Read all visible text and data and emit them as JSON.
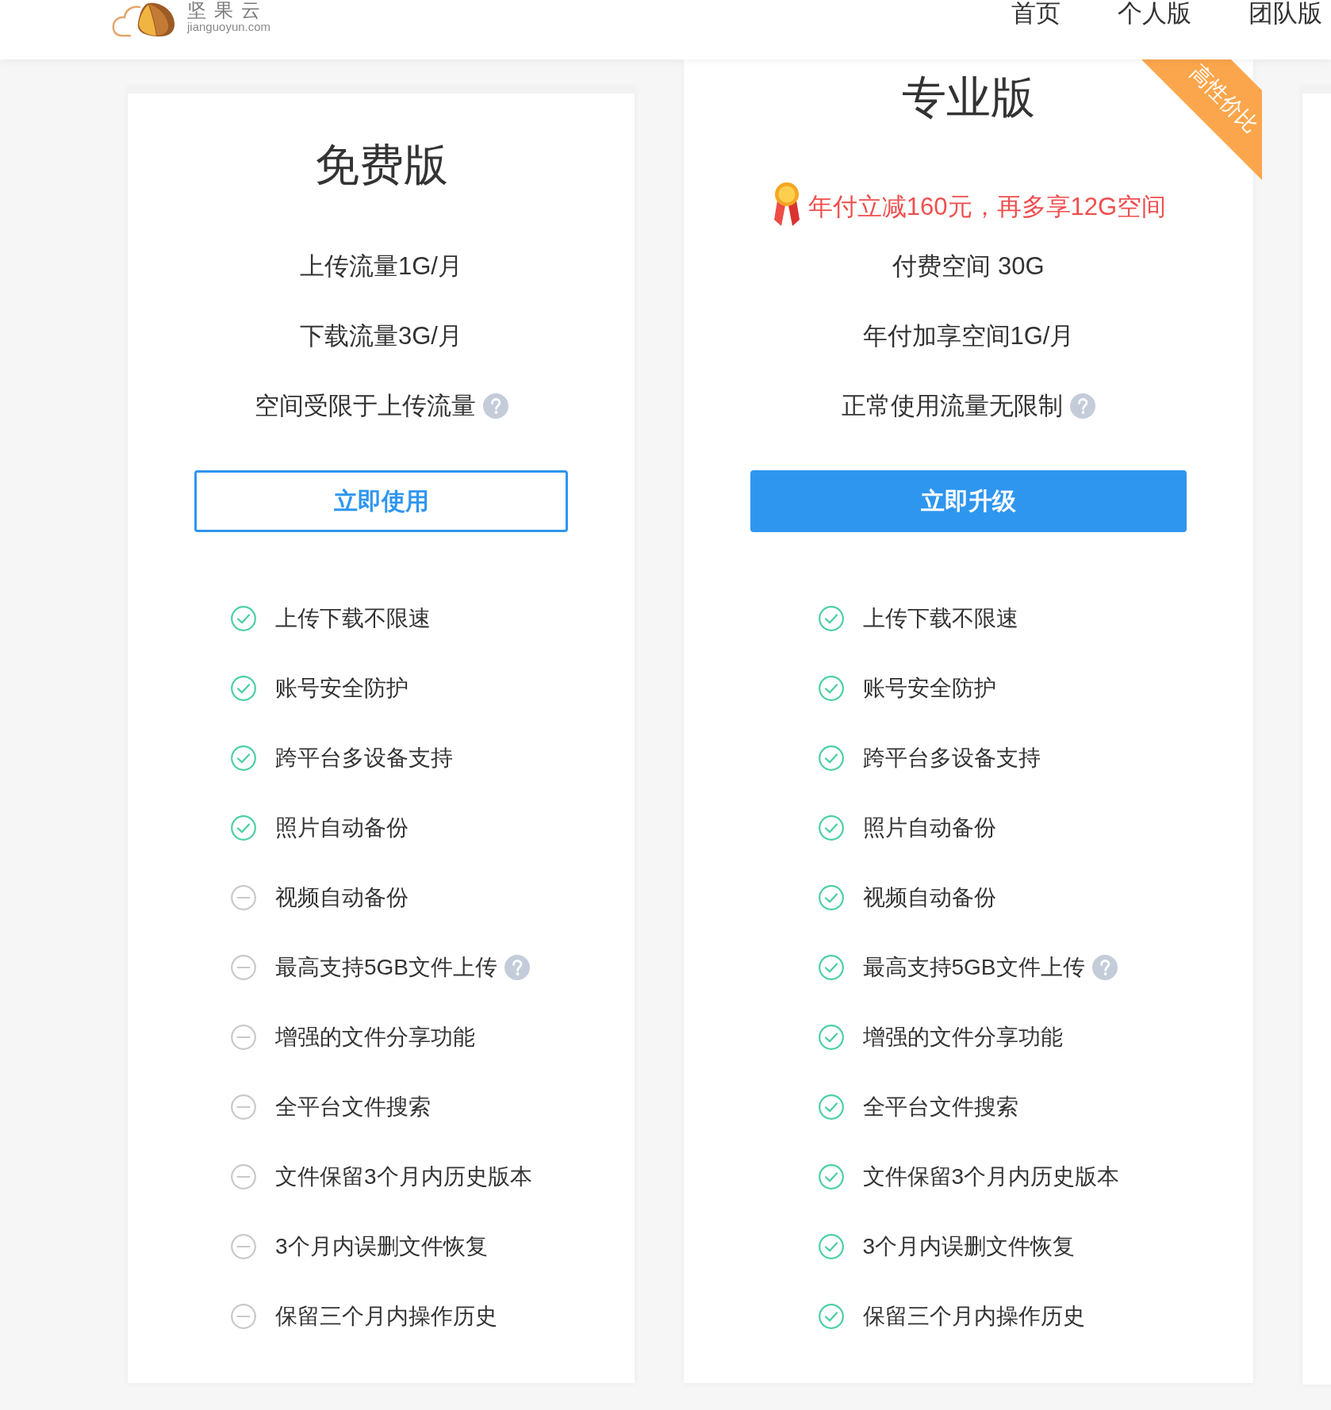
{
  "header": {
    "logo": {
      "name": "坚果云",
      "domain": "jianguoyun.com"
    },
    "nav": [
      {
        "label": "首页",
        "selected": false
      },
      {
        "label": "个人版",
        "selected": false
      },
      {
        "label": "团队版",
        "selected": false
      }
    ]
  },
  "plans": [
    {
      "title": "免费版",
      "featured": false,
      "specs": [
        {
          "text": "上传流量1G/月"
        },
        {
          "text": "下载流量3G/月"
        },
        {
          "text": "空间受限于上传流量",
          "help": true
        }
      ],
      "button": {
        "label": "立即使用",
        "kind": "outline"
      },
      "features": [
        {
          "text": "上传下载不限速",
          "included": true
        },
        {
          "text": "账号安全防护",
          "included": true
        },
        {
          "text": "跨平台多设备支持",
          "included": true
        },
        {
          "text": "照片自动备份",
          "included": true
        },
        {
          "text": "视频自动备份",
          "included": false
        },
        {
          "text": "最高支持5GB文件上传",
          "included": false,
          "help": true
        },
        {
          "text": "增强的文件分享功能",
          "included": false
        },
        {
          "text": "全平台文件搜索",
          "included": false
        },
        {
          "text": "文件保留3个月内历史版本",
          "included": false
        },
        {
          "text": "3个月内误删文件恢复",
          "included": false
        },
        {
          "text": "保留三个月内操作历史",
          "included": false
        }
      ]
    },
    {
      "title": "专业版",
      "featured": true,
      "ribbon": "高性价比",
      "promo": "年付立减160元，再多享12G空间",
      "specs": [
        {
          "text": "付费空间 30G"
        },
        {
          "text": "年付加享空间1G/月"
        },
        {
          "text": "正常使用流量无限制",
          "help": true
        }
      ],
      "button": {
        "label": "立即升级",
        "kind": "filled"
      },
      "features": [
        {
          "text": "上传下载不限速",
          "included": true
        },
        {
          "text": "账号安全防护",
          "included": true
        },
        {
          "text": "跨平台多设备支持",
          "included": true
        },
        {
          "text": "照片自动备份",
          "included": true
        },
        {
          "text": "视频自动备份",
          "included": true
        },
        {
          "text": "最高支持5GB文件上传",
          "included": true,
          "help": true
        },
        {
          "text": "增强的文件分享功能",
          "included": true
        },
        {
          "text": "全平台文件搜索",
          "included": true
        },
        {
          "text": "文件保留3个月内历史版本",
          "included": true
        },
        {
          "text": "3个月内误删文件恢复",
          "included": true
        },
        {
          "text": "保留三个月内操作历史",
          "included": true
        }
      ]
    }
  ]
}
